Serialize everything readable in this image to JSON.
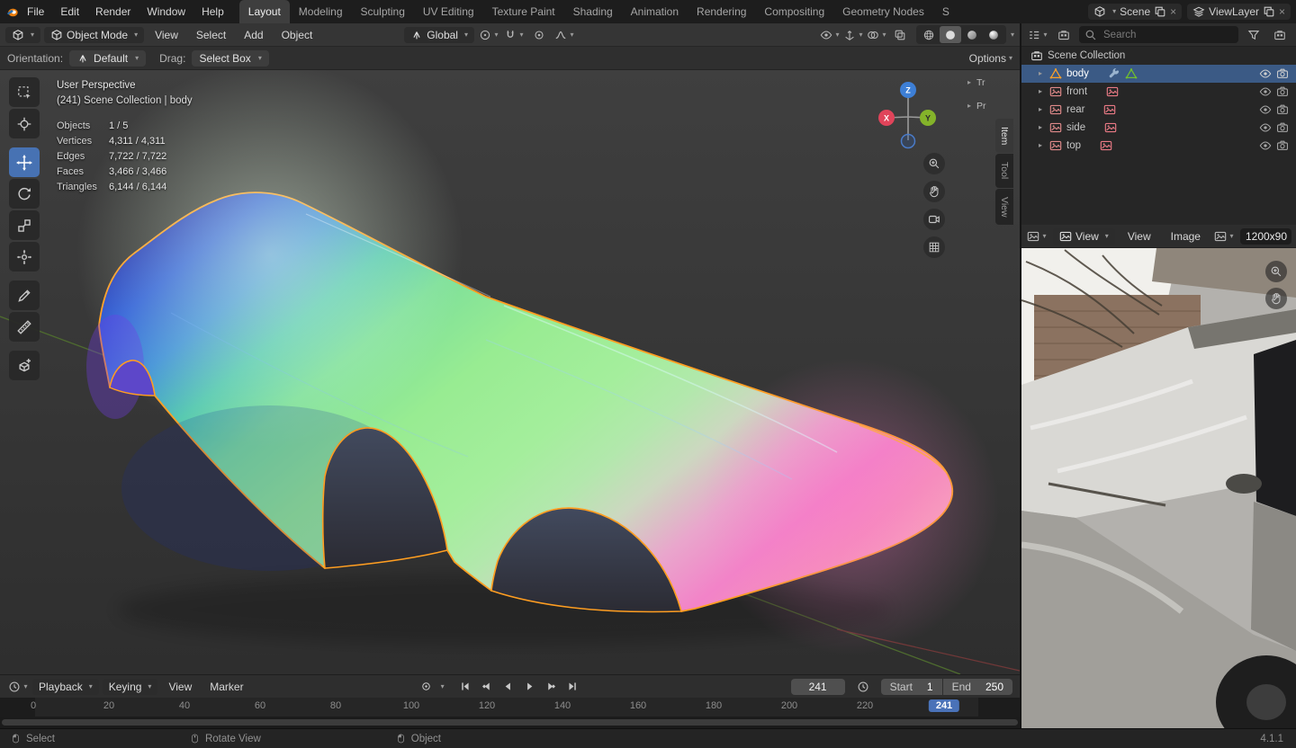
{
  "icons": {
    "chevron_down": "▾",
    "disclosure": "▸",
    "close": "×"
  },
  "topbar": {
    "menus": [
      "File",
      "Edit",
      "Render",
      "Window",
      "Help"
    ],
    "workspaces": [
      "Layout",
      "Modeling",
      "Sculpting",
      "UV Editing",
      "Texture Paint",
      "Shading",
      "Animation",
      "Rendering",
      "Compositing",
      "Geometry Nodes",
      "S"
    ],
    "scene_name": "Scene",
    "viewlayer_name": "ViewLayer"
  },
  "viewport": {
    "header": {
      "mode": "Object Mode",
      "menus": [
        "View",
        "Select",
        "Add",
        "Object"
      ],
      "orientation": "Global"
    },
    "tool_settings": {
      "orientation_label": "Orientation:",
      "orientation_value": "Default",
      "drag_label": "Drag:",
      "drag_value": "Select Box",
      "options_label": "Options"
    },
    "overlay": {
      "view_name": "User Perspective",
      "context_line": "(241) Scene Collection | body",
      "stats": [
        {
          "label": "Objects",
          "value": "1 / 5"
        },
        {
          "label": "Vertices",
          "value": "4,311 / 4,311"
        },
        {
          "label": "Edges",
          "value": "7,722 / 7,722"
        },
        {
          "label": "Faces",
          "value": "3,466 / 3,466"
        },
        {
          "label": "Triangles",
          "value": "6,144 / 6,144"
        }
      ]
    },
    "axis_gizmo": {
      "x_label": "X",
      "y_label": "Y",
      "z_label": "Z"
    },
    "collapsed_panels": {
      "tr": "Tr",
      "pr": "Pr"
    },
    "sidebar_tabs": [
      "Item",
      "Tool",
      "View"
    ]
  },
  "outliner": {
    "search_placeholder": "Search",
    "root_collection": "Scene Collection",
    "items": [
      {
        "name": "body"
      },
      {
        "name": "front"
      },
      {
        "name": "rear"
      },
      {
        "name": "side"
      },
      {
        "name": "top"
      }
    ]
  },
  "image_editor": {
    "mode": "View",
    "menus": [
      "View",
      "Image"
    ],
    "image_name": "1200x90"
  },
  "timeline": {
    "playback_label": "Playback",
    "keying_label": "Keying",
    "menus": [
      "View",
      "Marker"
    ],
    "current_frame": "241",
    "frame_badge": "241",
    "start_label": "Start",
    "start_value": "1",
    "end_label": "End",
    "end_value": "250",
    "ruler_ticks": [
      "0",
      "20",
      "40",
      "60",
      "80",
      "100",
      "120",
      "140",
      "160",
      "180",
      "200",
      "220"
    ]
  },
  "statusbar": {
    "hints": [
      "Select",
      "Rotate View",
      "Object"
    ],
    "version": "4.1.1"
  },
  "colors": {
    "accent": "#4772b3",
    "selection_outline": "#ff9e21"
  }
}
